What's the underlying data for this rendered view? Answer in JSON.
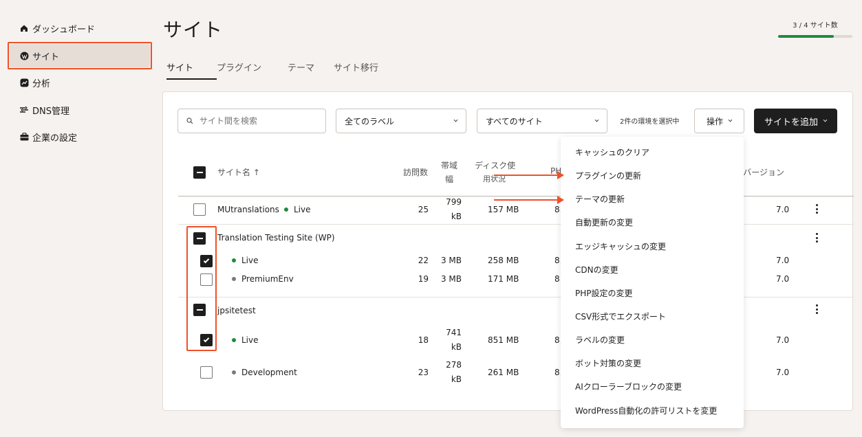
{
  "sidebar": {
    "items": [
      {
        "label": "ダッシュボード",
        "icon": "home-icon"
      },
      {
        "label": "サイト",
        "icon": "wordpress-icon"
      },
      {
        "label": "分析",
        "icon": "analytics-icon"
      },
      {
        "label": "DNS管理",
        "icon": "dns-icon"
      },
      {
        "label": "企業の設定",
        "icon": "briefcase-icon"
      }
    ]
  },
  "header": {
    "title": "サイト",
    "quota_label": "3 / 4 サイト数",
    "quota_fraction": 0.75
  },
  "tabs": [
    "サイト",
    "プラグイン",
    "テーマ",
    "サイト移行"
  ],
  "toolbar": {
    "search_placeholder": "サイト間を検索",
    "label_filter": "全てのラベル",
    "site_filter": "すべてのサイト",
    "selection_info": "2件の環境を選択中",
    "ops_label": "操作",
    "add_label": "サイトを追加"
  },
  "table": {
    "headers": {
      "name": "サイト名 ↑",
      "visits": "訪問数",
      "bandwidth_1": "帯域",
      "bandwidth_2": "幅",
      "disk_1": "ディスク使",
      "disk_2": "用状況",
      "php_partial": "PH",
      "wp_partial": "Pバージョン"
    },
    "rows": [
      {
        "name": "MUtranslations",
        "env": "Live",
        "visits": "25",
        "bw_1": "799",
        "bw_2": "kB",
        "disk": "157 MB",
        "php": "8.",
        "wp": "7.0"
      },
      {
        "site": "Translation Testing Site (WP)"
      },
      {
        "env": "Live",
        "visits": "22",
        "bw": "3 MB",
        "disk": "258 MB",
        "php": "8.",
        "wp": "7.0"
      },
      {
        "env": "PremiumEnv",
        "visits": "19",
        "bw": "3 MB",
        "disk": "171 MB",
        "php": "8.",
        "wp": "7.0"
      },
      {
        "site": "jpsitetest"
      },
      {
        "env": "Live",
        "visits": "18",
        "bw_1": "741",
        "bw_2": "kB",
        "disk": "851 MB",
        "php": "8.",
        "wp": "7.0"
      },
      {
        "env": "Development",
        "visits": "23",
        "bw_1": "278",
        "bw_2": "kB",
        "disk": "261 MB",
        "php": "8.",
        "wp": "7.0"
      }
    ]
  },
  "menu": {
    "items": [
      "キャッシュのクリア",
      "プラグインの更新",
      "テーマの更新",
      "自動更新の変更",
      "エッジキャッシュの変更",
      "CDNの変更",
      "PHP設定の変更",
      "CSV形式でエクスポート",
      "ラベルの変更",
      "ボット対策の変更",
      "AIクローラーブロックの変更",
      "WordPress自動化の許可リストを変更"
    ]
  },
  "colors": {
    "accent_red": "#f0502a",
    "live_green": "#1f8b3d",
    "env_grey": "#7a7a7a",
    "primary_dark": "#1e1e1e"
  }
}
